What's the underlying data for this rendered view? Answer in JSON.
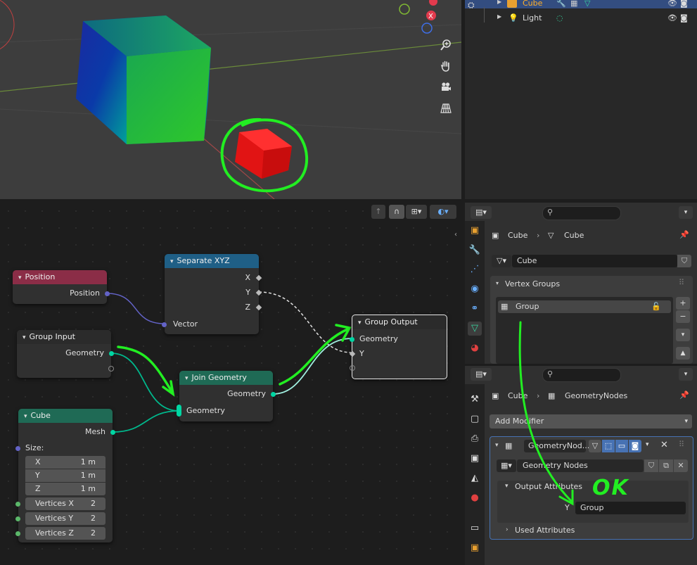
{
  "outliner": {
    "rows": [
      {
        "name": "Cube",
        "selected": true
      },
      {
        "name": "Light",
        "selected": false
      }
    ]
  },
  "node_editor": {
    "nodes": {
      "position": {
        "title": "Position",
        "outputs": [
          "Position"
        ],
        "color": "#8b2d47"
      },
      "separate_xyz": {
        "title": "Separate XYZ",
        "outputs": [
          "X",
          "Y",
          "Z"
        ],
        "input": "Vector",
        "color": "#1f5f86"
      },
      "group_input": {
        "title": "Group Input",
        "outputs": [
          "Geometry"
        ],
        "color": "#2b2b2b"
      },
      "join_geometry": {
        "title": "Join Geometry",
        "output": "Geometry",
        "input": "Geometry",
        "color": "#1f6a55"
      },
      "group_output": {
        "title": "Group Output",
        "inputs": [
          "Geometry",
          "Y"
        ],
        "color": "#2b2b2b"
      },
      "cube": {
        "title": "Cube",
        "output": "Mesh",
        "size_label": "Size:",
        "color": "#1f6a55",
        "fields": [
          {
            "label": "X",
            "value": "1 m"
          },
          {
            "label": "Y",
            "value": "1 m"
          },
          {
            "label": "Z",
            "value": "1 m"
          },
          {
            "label": "Vertices X",
            "value": "2"
          },
          {
            "label": "Vertices Y",
            "value": "2"
          },
          {
            "label": "Vertices Z",
            "value": "2"
          }
        ]
      }
    },
    "annotation_ok": "OK"
  },
  "properties_data": {
    "breadcrumb": [
      "Cube",
      "Cube"
    ],
    "mesh_name": "Cube",
    "vertex_groups_title": "Vertex Groups",
    "vertex_group_item": "Group"
  },
  "properties_modifiers": {
    "breadcrumb": [
      "Cube",
      "GeometryNodes"
    ],
    "add_modifier": "Add Modifier",
    "modifier_name": "GeometryNod...",
    "node_group": "Geometry Nodes",
    "output_attributes": "Output Attributes",
    "attr_label": "Y",
    "attr_value": "Group",
    "used_attributes": "Used Attributes"
  },
  "colors": {
    "accent_green_annotation": "#22ee22",
    "geometry_socket": "#00d6a3",
    "vector_socket": "#6363c7"
  }
}
